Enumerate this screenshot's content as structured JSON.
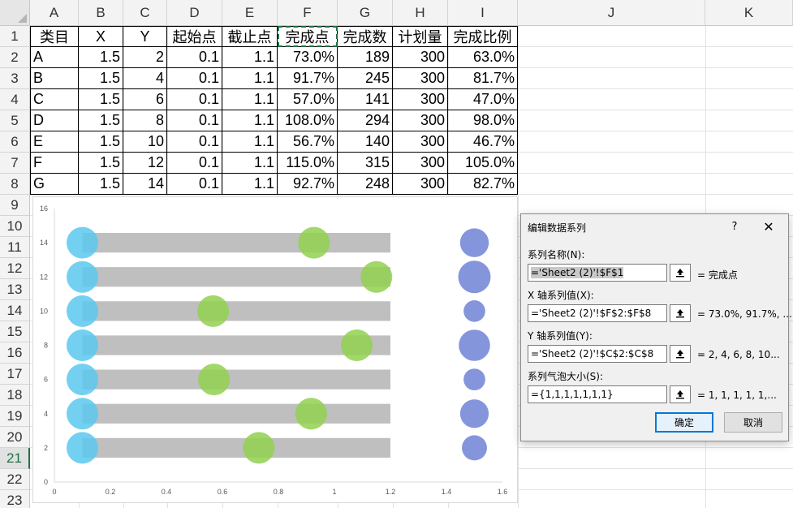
{
  "spreadsheet": {
    "columns": [
      "A",
      "B",
      "C",
      "D",
      "E",
      "F",
      "G",
      "H",
      "I",
      "J",
      "K"
    ],
    "rows": [
      "1",
      "2",
      "3",
      "4",
      "5",
      "6",
      "7",
      "8",
      "9",
      "10",
      "11",
      "12",
      "13",
      "14",
      "15",
      "16",
      "17",
      "18",
      "19",
      "20",
      "21",
      "22",
      "23"
    ],
    "active_row": "21",
    "headers": [
      "类目",
      "X",
      "Y",
      "起始点",
      "截止点",
      "完成点",
      "完成数",
      "计划量",
      "完成比例"
    ],
    "table": [
      [
        "A",
        "1.5",
        "2",
        "0.1",
        "1.1",
        "73.0%",
        "189",
        "300",
        "63.0%"
      ],
      [
        "B",
        "1.5",
        "4",
        "0.1",
        "1.1",
        "91.7%",
        "245",
        "300",
        "81.7%"
      ],
      [
        "C",
        "1.5",
        "6",
        "0.1",
        "1.1",
        "57.0%",
        "141",
        "300",
        "47.0%"
      ],
      [
        "D",
        "1.5",
        "8",
        "0.1",
        "1.1",
        "108.0%",
        "294",
        "300",
        "98.0%"
      ],
      [
        "E",
        "1.5",
        "10",
        "0.1",
        "1.1",
        "56.7%",
        "140",
        "300",
        "46.7%"
      ],
      [
        "F",
        "1.5",
        "12",
        "0.1",
        "1.1",
        "115.0%",
        "315",
        "300",
        "105.0%"
      ],
      [
        "G",
        "1.5",
        "14",
        "0.1",
        "1.1",
        "92.7%",
        "248",
        "300",
        "82.7%"
      ]
    ]
  },
  "chart_data": {
    "type": "scatter",
    "title": "",
    "xlim": [
      0,
      1.6
    ],
    "ylim": [
      0,
      16
    ],
    "x_ticks": [
      "0",
      "0.2",
      "0.4",
      "0.6",
      "0.8",
      "1",
      "1.2",
      "1.4",
      "1.6"
    ],
    "y_ticks": [
      "0",
      "2",
      "4",
      "6",
      "8",
      "10",
      "12",
      "14",
      "16"
    ],
    "bars": {
      "start": 0.1,
      "end": 1.2,
      "y": [
        2,
        4,
        6,
        8,
        10,
        12,
        14
      ],
      "color": "#bfbfbf"
    },
    "series": [
      {
        "color": "#5bc8ef",
        "points": [
          [
            0.1,
            2
          ],
          [
            0.1,
            4
          ],
          [
            0.1,
            6
          ],
          [
            0.1,
            8
          ],
          [
            0.1,
            10
          ],
          [
            0.1,
            12
          ],
          [
            0.1,
            14
          ]
        ],
        "size": [
          1,
          1,
          1,
          1,
          1,
          1,
          1
        ]
      },
      {
        "color": "#92d050",
        "points": [
          [
            0.73,
            2
          ],
          [
            0.917,
            4
          ],
          [
            0.57,
            6
          ],
          [
            1.08,
            8
          ],
          [
            0.567,
            10
          ],
          [
            1.15,
            12
          ],
          [
            0.927,
            14
          ]
        ],
        "size": [
          1,
          1,
          1,
          1,
          1,
          1,
          1
        ]
      },
      {
        "color": "#6f83d6",
        "points": [
          [
            1.5,
            2
          ],
          [
            1.5,
            4
          ],
          [
            1.5,
            6
          ],
          [
            1.5,
            8
          ],
          [
            1.5,
            10
          ],
          [
            1.5,
            12
          ],
          [
            1.5,
            14
          ]
        ],
        "size": [
          0.63,
          0.817,
          0.47,
          0.98,
          0.467,
          1.05,
          0.827
        ]
      }
    ]
  },
  "dialog": {
    "title": "编辑数据系列",
    "help": "?",
    "close": "✕",
    "fields": [
      {
        "label": "系列名称(N):",
        "value": "='Sheet2 (2)'!$F$1",
        "preview": "= 完成点"
      },
      {
        "label": "X 轴系列值(X):",
        "value": "='Sheet2 (2)'!$F$2:$F$8",
        "preview": "= 73.0%, 91.7%, ..."
      },
      {
        "label": "Y 轴系列值(Y):",
        "value": "='Sheet2 (2)'!$C$2:$C$8",
        "preview": "= 2, 4, 6, 8, 10..."
      },
      {
        "label": "系列气泡大小(S):",
        "value": "={1,1,1,1,1,1,1}",
        "preview": "= 1, 1, 1, 1, 1,..."
      }
    ],
    "ref_icon": "collapse-dialog-icon",
    "ok_label": "确定",
    "cancel_label": "取消"
  }
}
